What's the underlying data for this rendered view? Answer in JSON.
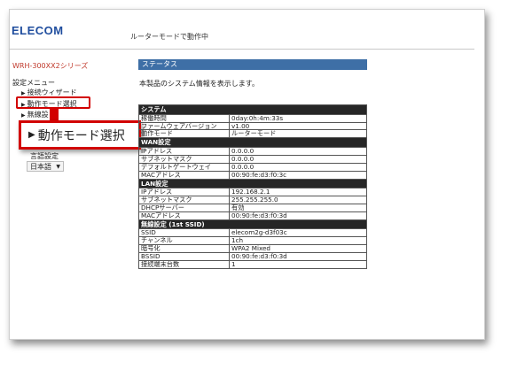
{
  "header": {
    "logo": "ELECOM",
    "status": "ルーターモードで動作中"
  },
  "sidebar": {
    "model": "WRH-300XX2シリーズ",
    "menu_title": "設定メニュー",
    "items": [
      {
        "label": "接続ウィザード"
      },
      {
        "label": "動作モード選択"
      },
      {
        "label": "無線設"
      }
    ],
    "zoom_label": "動作モード選択",
    "language_title": "言語設定",
    "language_value": "日本語"
  },
  "main": {
    "title": "ステータス",
    "description": "本製品のシステム情報を表示します。",
    "sections": [
      {
        "title": "システム",
        "rows": [
          {
            "label": "稼働時間",
            "value": "0day:0h:4m:33s"
          },
          {
            "label": "ファームウェアバージョン",
            "value": "v1.00"
          },
          {
            "label": "動作モード",
            "value": "ルーターモード"
          }
        ]
      },
      {
        "title": "WAN設定",
        "rows": [
          {
            "label": "IPアドレス",
            "value": "0.0.0.0"
          },
          {
            "label": "サブネットマスク",
            "value": "0.0.0.0"
          },
          {
            "label": "デフォルトゲートウェイ",
            "value": "0.0.0.0"
          },
          {
            "label": "MACアドレス",
            "value": "00:90:fe:d3:f0:3c"
          }
        ]
      },
      {
        "title": "LAN設定",
        "rows": [
          {
            "label": "IPアドレス",
            "value": "192.168.2.1"
          },
          {
            "label": "サブネットマスク",
            "value": "255.255.255.0"
          },
          {
            "label": "DHCPサーバー",
            "value": "有効"
          },
          {
            "label": "MACアドレス",
            "value": "00:90:fe:d3:f0:3d"
          }
        ]
      },
      {
        "title": "無線設定 (1st SSID)",
        "rows": [
          {
            "label": "SSID",
            "value": "elecom2g-d3f03c"
          },
          {
            "label": "チャンネル",
            "value": "1ch"
          },
          {
            "label": "暗号化",
            "value": "WPA2 Mixed"
          },
          {
            "label": "BSSID",
            "value": "00:90:fe:d3:f0:3d"
          },
          {
            "label": "接続端末台数",
            "value": "1"
          }
        ]
      }
    ]
  },
  "colors": {
    "accent": "#3e6fa6",
    "logo": "#1f4d9e",
    "highlight": "#d20000",
    "section_header": "#262626"
  }
}
